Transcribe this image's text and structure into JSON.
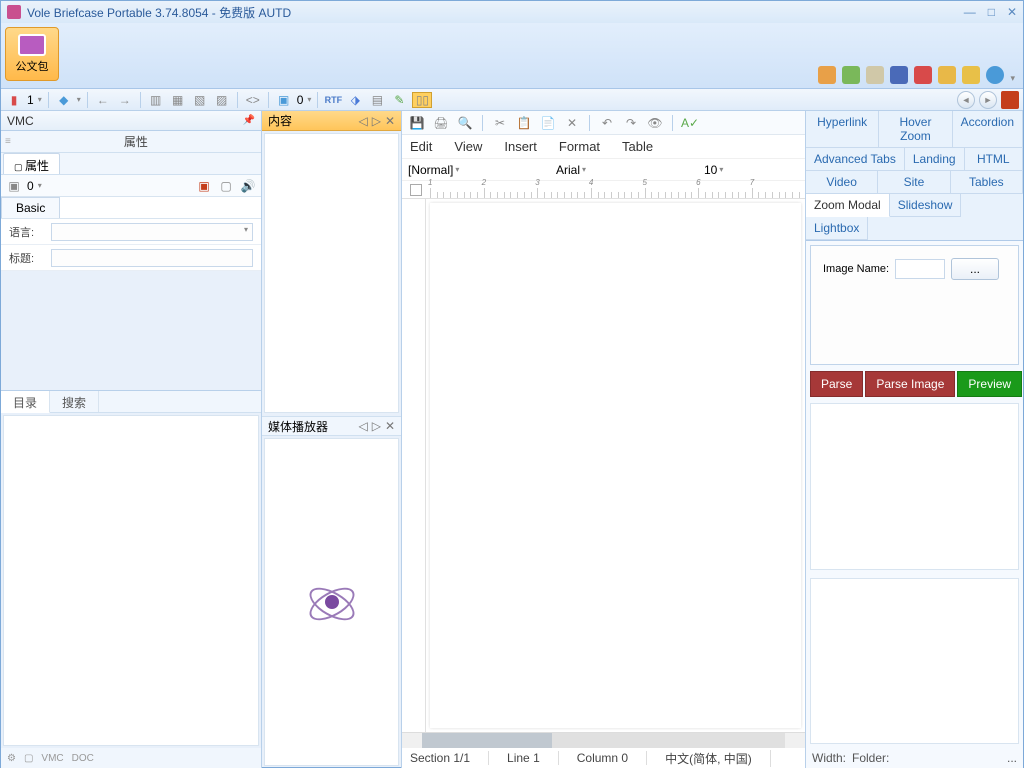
{
  "window": {
    "title": "Vole Briefcase Portable  3.74.8054 - 免费版 AUTD"
  },
  "ribbon": {
    "button_label": "公文包"
  },
  "toolbar2": {
    "count1": "1",
    "count2": "0",
    "count3": "0"
  },
  "left": {
    "vmc_title": "VMC",
    "properties_title": "属性",
    "properties_tab": "属性",
    "count": "0",
    "basic_tab": "Basic",
    "lang_label": "语言:",
    "title_label": "标题:",
    "catalog_tab": "目录",
    "search_tab": "搜索",
    "footer_vmc": "VMC",
    "footer_doc": "DOC"
  },
  "mid": {
    "content_title": "内容",
    "media_title": "媒体播放器"
  },
  "editor": {
    "menu": {
      "edit": "Edit",
      "view": "View",
      "insert": "Insert",
      "format": "Format",
      "table": "Table"
    },
    "style": "[Normal]",
    "font": "Arial",
    "size": "10",
    "status": {
      "section": "Section 1/1",
      "line": "Line 1",
      "column": "Column 0",
      "lang": "中文(简体, 中国)"
    }
  },
  "right": {
    "tabs": {
      "hyperlink": "Hyperlink",
      "hoverzoom": "Hover Zoom",
      "accordion": "Accordion",
      "advtabs": "Advanced Tabs",
      "landing": "Landing",
      "html": "HTML",
      "video": "Video",
      "site": "Site",
      "tables": "Tables",
      "zoommodal": "Zoom Modal",
      "slideshow": "Slideshow",
      "lightbox": "Lightbox"
    },
    "image_name_label": "Image Name:",
    "browse": "...",
    "parse": "Parse",
    "parse_image": "Parse Image",
    "preview": "Preview",
    "width_label": "Width:",
    "folder_label": "Folder:",
    "dots": "..."
  }
}
